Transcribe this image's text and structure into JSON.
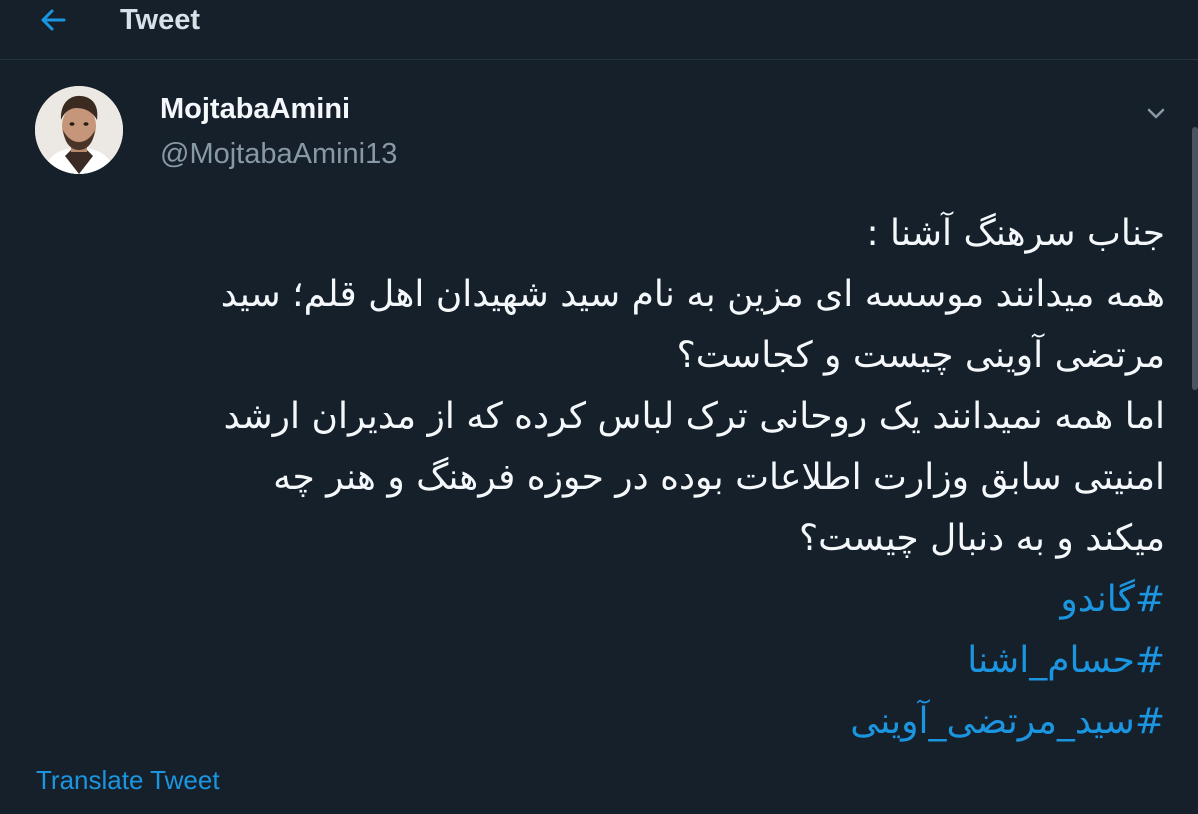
{
  "header": {
    "title": "Tweet",
    "back_icon": "back-arrow-icon"
  },
  "author": {
    "display_name": "MojtabaAmini",
    "handle": "@MojtabaAmini13"
  },
  "tweet": {
    "lines": [
      "جناب سرهنگ آشنا :",
      "همه میدانند موسسه ای مزین به نام سید شهیدان اهل قلم؛ سید",
      "مرتضی آوینی چیست و کجاست؟",
      "اما همه نمیدانند یک روحانی ترک لباس کرده که از مدیران ارشد",
      "امنیتی سابق وزارت اطلاعات بوده در حوزه فرهنگ و هنر چه",
      "میکند و به دنبال چیست؟"
    ],
    "hashtags": [
      "#گاندو",
      "#حسام_اشنا",
      "#سید_مرتضی_آوینی"
    ]
  },
  "actions": {
    "translate_label": "Translate Tweet",
    "menu_icon": "chevron-down-icon"
  },
  "colors": {
    "background": "#15202b",
    "accent": "#1b95e0",
    "text": "#f5f8fa",
    "muted": "#8899a6"
  }
}
